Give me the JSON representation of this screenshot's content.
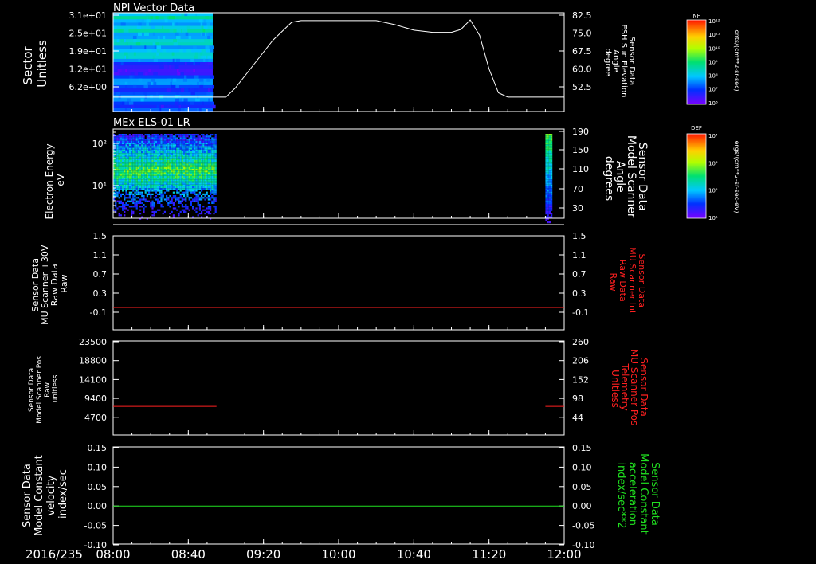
{
  "colors": {
    "background": "#000000",
    "foreground": "#ffffff",
    "red": "#ff2020",
    "green": "#20e020"
  },
  "footer": {
    "date": "2016/235"
  },
  "x_axis": {
    "type": "time",
    "range": [
      "08:00",
      "12:00"
    ],
    "tick_labels": [
      "08:00",
      "08:40",
      "09:20",
      "10:00",
      "10:40",
      "11:20",
      "12:00"
    ]
  },
  "colorbars": [
    {
      "label": "NF",
      "top": "10¹²",
      "ticks": [
        "10¹²",
        "10¹¹",
        "10¹⁰",
        "10⁹",
        "10⁸",
        "10⁷",
        "10⁶"
      ],
      "unit": "cnts/(cm**2-sr-sec)"
    },
    {
      "label": "DEF",
      "top": "10⁴",
      "ticks": [
        "10⁴",
        "10³",
        "10²",
        "10¹"
      ],
      "unit": "ergs/(cm**2-sr-sec-eV)"
    }
  ],
  "chart_data": [
    {
      "type": "heatmap",
      "title": "NPI Vector Data",
      "ylabel": [
        "Sector",
        "Unitless"
      ],
      "yticks": [
        "3.1e+01",
        "2.5e+01",
        "1.9e+01",
        "1.2e+01",
        "6.2e+00"
      ],
      "colorbar": "NF",
      "data_span": [
        "08:00",
        "08:53"
      ],
      "right_axis": {
        "label": [
          "Sensor Data",
          "ESH Sun Elevation",
          "Angle",
          "degree"
        ],
        "ticks": [
          "82.5",
          "75.0",
          "67.5",
          "60.0",
          "52.5"
        ],
        "ylim": [
          45,
          82.5
        ],
        "series": {
          "type": "line",
          "color": "#ffffff",
          "x": [
            "08:00",
            "08:40",
            "09:00",
            "09:05",
            "09:15",
            "09:25",
            "09:35",
            "09:40",
            "09:50",
            "10:00",
            "10:20",
            "10:30",
            "10:40",
            "10:50",
            "11:00",
            "11:05",
            "11:10",
            "11:15",
            "11:20",
            "11:25",
            "11:30",
            "12:00"
          ],
          "y": [
            48.2,
            48.2,
            48.2,
            52,
            62,
            72,
            79.5,
            80.2,
            80.2,
            80.2,
            80.2,
            78.5,
            76.2,
            75.3,
            75.3,
            76.5,
            80.5,
            74,
            60,
            50,
            48.2,
            48.2
          ]
        }
      }
    },
    {
      "type": "heatmap",
      "title": "MEx ELS-01 LR",
      "ylabel": [
        "Electron Energy",
        "eV"
      ],
      "yscale": "log",
      "yticks": [
        "10²",
        "10¹"
      ],
      "colorbar": "DEF",
      "data_spans": [
        [
          "08:00",
          "08:55"
        ],
        [
          "11:50",
          "11:53"
        ]
      ],
      "right_axis": {
        "label": [
          "Sensor Data",
          "Model Scanner",
          "Angle",
          "degrees"
        ],
        "ticks": [
          "190",
          "150",
          "110",
          "70",
          "30"
        ]
      }
    },
    {
      "type": "line",
      "ylabel": [
        "Sensor Data",
        "MU Scanner +30V",
        "Raw Data",
        "Raw"
      ],
      "yticks": [
        "1.5",
        "1.1",
        "0.7",
        "0.3",
        "-0.1"
      ],
      "ylim": [
        -0.3,
        1.5
      ],
      "right_axis": {
        "label": [
          "Sensor Data",
          "MU Scanner Int",
          "Raw Data",
          "Raw"
        ],
        "ticks": [
          "1.5",
          "1.1",
          "0.7",
          "0.3",
          "-0.1"
        ],
        "label_color": "#ff2020"
      },
      "series": [
        {
          "color": "#ff2020",
          "x": [
            "08:00",
            "12:00"
          ],
          "y": [
            0,
            0
          ]
        }
      ]
    },
    {
      "type": "line",
      "ylabel": [
        "Sensor Data",
        "Model Scanner Pos",
        "Raw",
        "unitless"
      ],
      "yticks": [
        "23500",
        "18800",
        "14100",
        "9400",
        "4700"
      ],
      "ylim": [
        0,
        23500
      ],
      "right_axis": {
        "label": [
          "Sensor Data",
          "MU Scanner Pos",
          "Telemetry",
          "Unitless"
        ],
        "ticks": [
          "260",
          "206",
          "152",
          "98",
          "44"
        ],
        "label_color": "#ff2020"
      },
      "series": [
        {
          "color": "#ff2020",
          "segments": [
            {
              "x": [
                "08:00",
                "08:55"
              ],
              "y": [
                7400,
                7400
              ]
            },
            {
              "x": [
                "11:50",
                "12:00"
              ],
              "y": [
                7400,
                7400
              ]
            }
          ]
        }
      ]
    },
    {
      "type": "line",
      "ylabel": [
        "Sensor Data",
        "Model Constant",
        "velocity",
        "index/sec"
      ],
      "yticks": [
        "0.15",
        "0.10",
        "0.05",
        "0.00",
        "-0.05",
        "-0.10"
      ],
      "ylim": [
        -0.1,
        0.15
      ],
      "right_axis": {
        "label": [
          "Sensor Data",
          "Model Constant",
          "acceleration",
          "index/sec**2"
        ],
        "ticks": [
          "0.15",
          "0.10",
          "0.05",
          "0.00",
          "-0.05",
          "-0.10"
        ],
        "label_color": "#20e020"
      },
      "series": [
        {
          "color": "#20e020",
          "x": [
            "08:00",
            "12:00"
          ],
          "y": [
            0,
            0
          ]
        }
      ]
    }
  ]
}
